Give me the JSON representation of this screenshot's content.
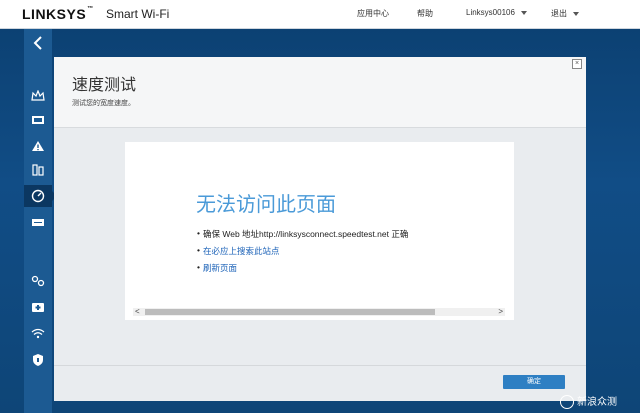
{
  "header": {
    "brand": "LINKSYS",
    "tm": "™",
    "product": "Smart Wi-Fi",
    "nav": {
      "app_center": "应用中心",
      "help": "帮助",
      "account": "Linksys00106",
      "logout": "退出"
    }
  },
  "sidebar": {
    "back_icon": "chevron-left-icon",
    "items": [
      {
        "icon": "crown-icon"
      },
      {
        "icon": "devices-icon"
      },
      {
        "icon": "warning-icon"
      },
      {
        "icon": "parental-icon"
      },
      {
        "icon": "speed-gauge-icon",
        "active": true
      },
      {
        "icon": "media-icon"
      },
      {
        "icon": "settings-gears-icon"
      },
      {
        "icon": "security-icon"
      },
      {
        "icon": "wifi-icon"
      },
      {
        "icon": "shield-icon"
      }
    ]
  },
  "panel": {
    "title": "速度测试",
    "subtitle": "测试您的宽度速度。",
    "error": {
      "title": "无法访问此页面",
      "line1": "确保 Web 地址http://linksysconnect.speedtest.net 正确",
      "line2": "在必应上搜索此站点",
      "line3": "刷新页面",
      "bullet": "•"
    },
    "ok_label": "确定"
  },
  "watermark": {
    "text": "新浪众测"
  },
  "colors": {
    "accent": "#2e7fc3",
    "background": "#0d3f6e",
    "error_title": "#4a9ad8"
  }
}
